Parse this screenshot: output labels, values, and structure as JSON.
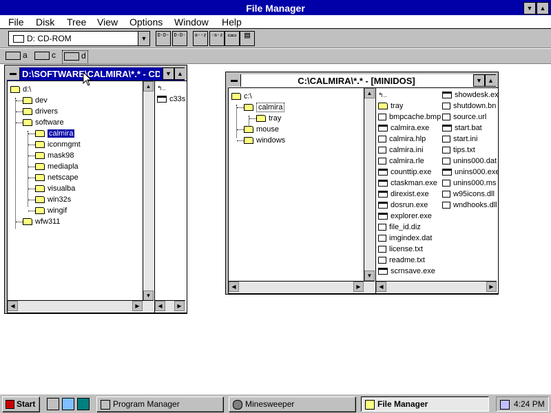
{
  "app": {
    "title": "File Manager"
  },
  "menu": [
    "File",
    "Disk",
    "Tree",
    "View",
    "Options",
    "Window",
    "Help"
  ],
  "toolbar": {
    "drive_selected": "D: CD-ROM",
    "buttons": [
      {
        "name": "view-tree-only",
        "glyph": "D-D-"
      },
      {
        "name": "view-tree-dir",
        "glyph": "D-D-"
      },
      {
        "name": "sort-by-name",
        "glyph": "a--z"
      },
      {
        "name": "sort-by-type",
        "glyph": "-a-z"
      },
      {
        "name": "copy",
        "glyph": "▭▭"
      },
      {
        "name": "properties",
        "glyph": "▤"
      }
    ]
  },
  "drives": [
    {
      "letter": "a",
      "icon": "floppy-drive-icon"
    },
    {
      "letter": "c",
      "icon": "hard-drive-icon"
    },
    {
      "letter": "d",
      "icon": "cdrom-drive-icon"
    }
  ],
  "windows": {
    "left": {
      "title": "D:\\SOFTWARE\\CALMIRA\\*.* - CD",
      "tree": [
        {
          "name": "d:\\",
          "level": 0
        },
        {
          "name": "dev",
          "level": 1
        },
        {
          "name": "drivers",
          "level": 1
        },
        {
          "name": "software",
          "level": 1
        },
        {
          "name": "calmira",
          "level": 2,
          "selected": true
        },
        {
          "name": "iconmgmt",
          "level": 2
        },
        {
          "name": "mask98",
          "level": 2
        },
        {
          "name": "mediapla",
          "level": 2
        },
        {
          "name": "netscape",
          "level": 2
        },
        {
          "name": "visualba",
          "level": 2
        },
        {
          "name": "win32s",
          "level": 2
        },
        {
          "name": "wingif",
          "level": 2
        },
        {
          "name": "wfw311",
          "level": 1
        }
      ],
      "files": [
        {
          "name": "",
          "type": "up"
        },
        {
          "name": "c33s",
          "type": "exe"
        }
      ]
    },
    "right": {
      "title": "C:\\CALMIRA\\*.* - [MINIDOS]",
      "tree": [
        {
          "name": "c:\\",
          "level": 0
        },
        {
          "name": "calmira",
          "level": 1,
          "focused": true
        },
        {
          "name": "tray",
          "level": 2
        },
        {
          "name": "mouse",
          "level": 1
        },
        {
          "name": "windows",
          "level": 1
        }
      ],
      "files_col1": [
        {
          "name": "",
          "type": "up"
        },
        {
          "name": "tray",
          "type": "folder"
        },
        {
          "name": "bmpcache.bmp",
          "type": "file"
        },
        {
          "name": "calmira.exe",
          "type": "exe"
        },
        {
          "name": "calmira.hlp",
          "type": "file"
        },
        {
          "name": "calmira.ini",
          "type": "file"
        },
        {
          "name": "calmira.rle",
          "type": "file"
        },
        {
          "name": "counttip.exe",
          "type": "exe"
        },
        {
          "name": "ctaskman.exe",
          "type": "exe"
        },
        {
          "name": "direxist.exe",
          "type": "exe"
        },
        {
          "name": "dosrun.exe",
          "type": "exe"
        },
        {
          "name": "explorer.exe",
          "type": "exe"
        },
        {
          "name": "file_id.diz",
          "type": "file"
        },
        {
          "name": "imgindex.dat",
          "type": "file"
        },
        {
          "name": "license.txt",
          "type": "file"
        },
        {
          "name": "readme.txt",
          "type": "file"
        },
        {
          "name": "scrnsave.exe",
          "type": "exe"
        }
      ],
      "files_col2": [
        {
          "name": "showdesk.ex",
          "type": "exe"
        },
        {
          "name": "shutdown.bn",
          "type": "file"
        },
        {
          "name": "source.url",
          "type": "file"
        },
        {
          "name": "start.bat",
          "type": "exe"
        },
        {
          "name": "start.ini",
          "type": "file"
        },
        {
          "name": "tips.txt",
          "type": "file"
        },
        {
          "name": "unins000.dat",
          "type": "file"
        },
        {
          "name": "unins000.exe",
          "type": "exe"
        },
        {
          "name": "unins000.ms",
          "type": "file"
        },
        {
          "name": "w95icons.dll",
          "type": "file"
        },
        {
          "name": "wndhooks.dll",
          "type": "file"
        }
      ]
    }
  },
  "taskbar": {
    "start": "Start",
    "tasks": [
      {
        "label": "Program Manager",
        "pressed": false
      },
      {
        "label": "Minesweeper",
        "pressed": false
      },
      {
        "label": "File Manager",
        "pressed": true
      }
    ],
    "clock": "4:24 PM"
  }
}
